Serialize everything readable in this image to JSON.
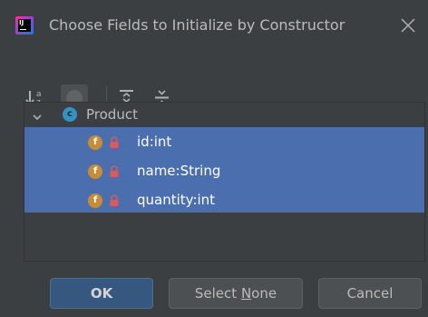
{
  "window": {
    "app_icon": "intellij-idea-icon",
    "app_icon_text": "IJ",
    "title": "Choose Fields to Initialize by Constructor",
    "close_icon": "close-icon"
  },
  "toolbar": {
    "items": [
      {
        "icon": "sort-alphabetically-icon"
      },
      {
        "icon": "show-inherited-toggle-icon",
        "state": "pressed"
      },
      {
        "icon": "expand-all-icon"
      },
      {
        "icon": "collapse-all-icon"
      }
    ]
  },
  "tree": {
    "root": {
      "label": "Product",
      "kind_letter": "c",
      "icon": "class-icon",
      "expanded": true
    },
    "fields": [
      {
        "label": "id:int",
        "kind_letter": "f",
        "icon": "field-icon",
        "access_icon": "private-lock-icon",
        "selected": true
      },
      {
        "label": "name:String",
        "kind_letter": "f",
        "icon": "field-icon",
        "access_icon": "private-lock-icon",
        "selected": true
      },
      {
        "label": "quantity:int",
        "kind_letter": "f",
        "icon": "field-icon",
        "access_icon": "private-lock-icon",
        "selected": true
      }
    ]
  },
  "buttons": {
    "ok": "OK",
    "select_none_prefix": "Select ",
    "select_none_mnemonic": "N",
    "select_none_suffix": "one",
    "cancel": "Cancel"
  },
  "colors": {
    "background": "#3c3f41",
    "selection": "#4b6eaf",
    "default_button": "#365880",
    "class_icon": "#3592c4",
    "field_icon": "#c88d34",
    "lock_icon": "#d75c5c"
  }
}
